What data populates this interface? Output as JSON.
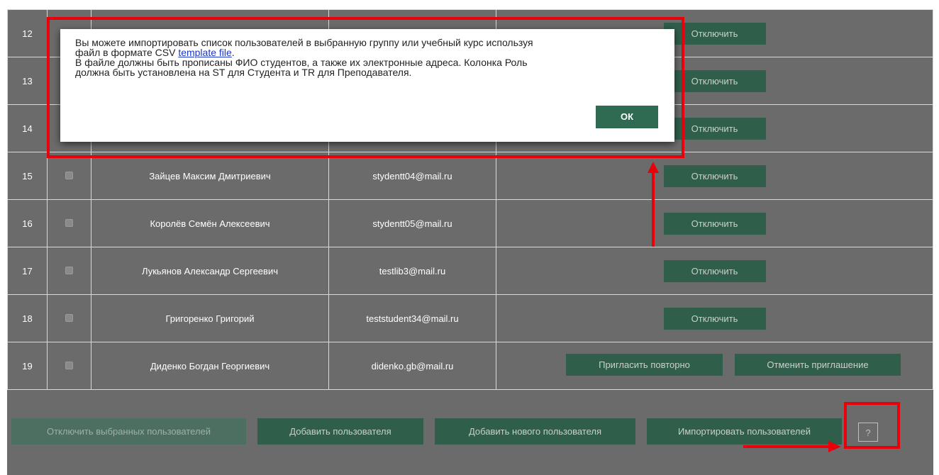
{
  "rows": [
    {
      "num": "12",
      "name": "",
      "email": "",
      "actions": [
        "Отключить"
      ]
    },
    {
      "num": "13",
      "name": "",
      "email": "",
      "actions": [
        "Отключить"
      ]
    },
    {
      "num": "14",
      "name": "",
      "email": "",
      "actions": [
        "Отключить"
      ]
    },
    {
      "num": "15",
      "name": "Зайцев Максим Дмитриевич",
      "email": "stydentt04@mail.ru",
      "actions": [
        "Отключить"
      ]
    },
    {
      "num": "16",
      "name": "Королёв Семён Алексеевич",
      "email": "stydentt05@mail.ru",
      "actions": [
        "Отключить"
      ]
    },
    {
      "num": "17",
      "name": "Лукьянов Александр Сергеевич",
      "email": "testlib3@mail.ru",
      "actions": [
        "Отключить"
      ]
    },
    {
      "num": "18",
      "name": "Григоренко Григорий",
      "email": "teststudent34@mail.ru",
      "actions": [
        "Отключить"
      ]
    },
    {
      "num": "19",
      "name": "Диденко Богдан Георгиевич",
      "email": "didenko.gb@mail.ru",
      "actions": [
        "Пригласить повторно",
        "Отменить приглашение"
      ]
    }
  ],
  "bottom": {
    "disable_selected": "Отключить выбранных пользователей",
    "add_user": "Добавить пользователя",
    "add_new_user": "Добавить нового пользователя",
    "import_users": "Импортировать пользователей",
    "help": "?"
  },
  "dialog": {
    "line1": "Вы можете импортировать список пользователей в выбранную группу или учебный курс используя",
    "line2_prefix": "файл в формате CSV ",
    "link": "template file",
    "line2_suffix": ".",
    "line3": "В файле должны быть прописаны ФИО студентов, а также их электронные адреса. Колонка Роль",
    "line4": "должна быть установлена на ST для Студента и TR для Преподавателя.",
    "ok": "ОК"
  },
  "colors": {
    "overlay_bg": "#6b6b6b",
    "button": "#2f5f4b",
    "highlight": "#e8000b",
    "link": "#1a37c8"
  }
}
